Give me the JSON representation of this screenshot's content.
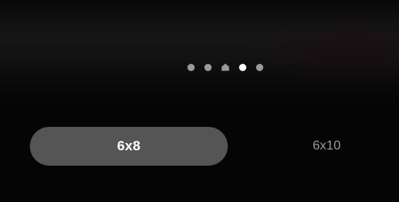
{
  "page_indicator": {
    "pages": [
      {
        "type": "dot",
        "active": false
      },
      {
        "type": "dot",
        "active": false
      },
      {
        "type": "home",
        "active": false
      },
      {
        "type": "dot",
        "active": true
      },
      {
        "type": "dot",
        "active": false
      }
    ],
    "active_color": "#ffffff",
    "inactive_color": "#9a9a9a",
    "home_icon": "house-icon"
  },
  "size_selector": {
    "options": [
      {
        "label": "6x8",
        "selected": true
      },
      {
        "label": "6x10",
        "selected": false
      }
    ],
    "selected_pill_color": "#555555"
  }
}
